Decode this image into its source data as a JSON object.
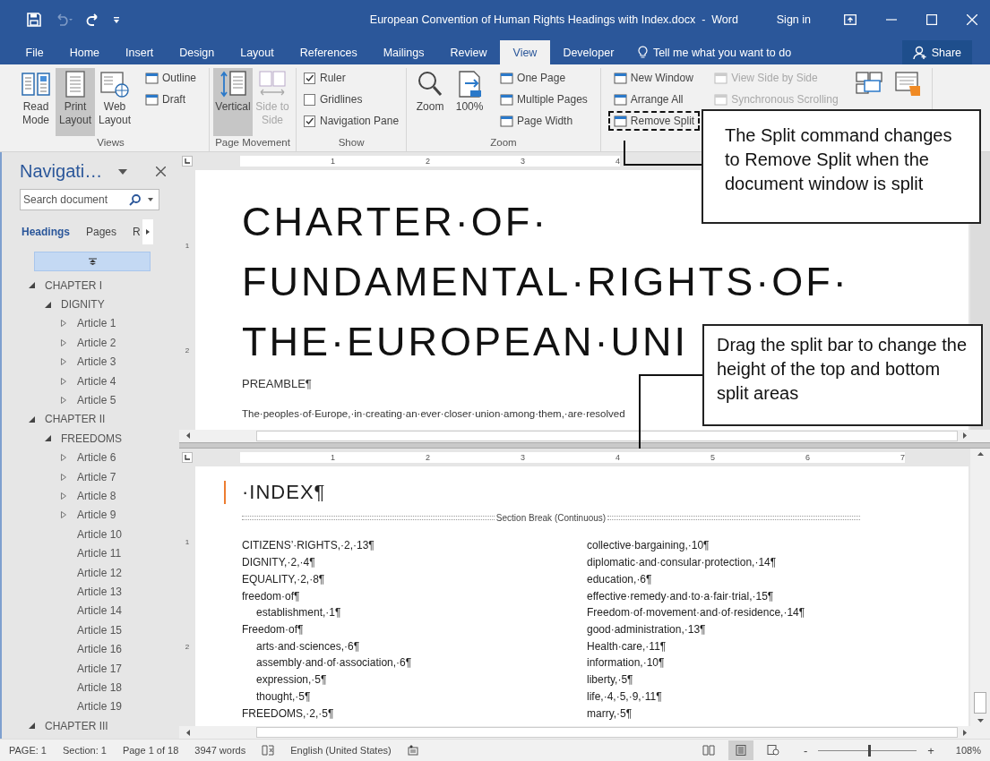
{
  "window": {
    "title": "European Convention of Human Rights Headings with Index.docx  -  Word",
    "sign_in": "Sign in"
  },
  "ribbon_tabs": [
    {
      "label": "File",
      "selected": false
    },
    {
      "label": "Home",
      "selected": false
    },
    {
      "label": "Insert",
      "selected": false
    },
    {
      "label": "Design",
      "selected": false
    },
    {
      "label": "Layout",
      "selected": false
    },
    {
      "label": "References",
      "selected": false
    },
    {
      "label": "Mailings",
      "selected": false
    },
    {
      "label": "Review",
      "selected": false
    },
    {
      "label": "View",
      "selected": true
    },
    {
      "label": "Developer",
      "selected": false
    }
  ],
  "tell_me": "Tell me what you want to do",
  "share": "Share",
  "ribbon": {
    "groups": [
      {
        "label": "Views",
        "columns": [
          {
            "kind": "large",
            "items": [
              {
                "label": "Read Mode",
                "selected": false,
                "disabled": false
              },
              {
                "label": "Print Layout",
                "selected": true,
                "disabled": false
              },
              {
                "label": "Web Layout",
                "selected": false,
                "disabled": false
              }
            ]
          },
          {
            "kind": "stack",
            "items": [
              {
                "label": "Outline",
                "disabled": false,
                "annotated": false
              },
              {
                "label": "Draft",
                "disabled": false,
                "annotated": false
              }
            ]
          }
        ]
      },
      {
        "label": "Page Movement",
        "columns": [
          {
            "kind": "large",
            "items": [
              {
                "label": "Vertical",
                "selected": true,
                "disabled": false
              },
              {
                "label": "Side to Side",
                "selected": false,
                "disabled": true
              }
            ]
          }
        ]
      },
      {
        "label": "Show",
        "columns": [
          {
            "kind": "checks",
            "items": [
              {
                "label": "Ruler",
                "checked": true
              },
              {
                "label": "Gridlines",
                "checked": false
              },
              {
                "label": "Navigation Pane",
                "checked": true
              }
            ]
          }
        ]
      },
      {
        "label": "Zoom",
        "columns": [
          {
            "kind": "large",
            "items": [
              {
                "label": "Zoom",
                "selected": false,
                "disabled": false
              },
              {
                "label": "100%",
                "selected": false,
                "disabled": false
              }
            ]
          },
          {
            "kind": "stack",
            "items": [
              {
                "label": "One Page",
                "disabled": false,
                "annotated": false
              },
              {
                "label": "Multiple Pages",
                "disabled": false,
                "annotated": false
              },
              {
                "label": "Page Width",
                "disabled": false,
                "annotated": false
              }
            ]
          }
        ]
      },
      {
        "columns": [
          {
            "kind": "stack",
            "items": [
              {
                "label": "New Window",
                "disabled": false,
                "annotated": false
              },
              {
                "label": "Arrange All",
                "disabled": false,
                "annotated": false
              },
              {
                "label": "Remove Split",
                "disabled": false,
                "annotated": true
              }
            ]
          },
          {
            "kind": "stack",
            "items": [
              {
                "label": "View Side by Side",
                "disabled": true,
                "annotated": false
              },
              {
                "label": "Synchronous Scrolling",
                "disabled": true,
                "annotated": false
              }
            ]
          },
          {
            "kind": "large",
            "items": [
              {
                "selected": false
              },
              {
                "selected": false
              }
            ]
          }
        ]
      }
    ]
  },
  "navigation": {
    "title": "Navigati…",
    "search": {
      "placeholder": "Search document"
    },
    "tabs": [
      {
        "label": "Headings",
        "selected": true
      },
      {
        "label": "Pages",
        "selected": false
      },
      {
        "label": "R",
        "selected": false
      }
    ],
    "tree": [
      {
        "text": "CHAPTER I",
        "expanded": true,
        "children": [
          {
            "text": "DIGNITY",
            "expanded": true,
            "children": [
              {
                "text": "Article 1",
                "expanded": false
              },
              {
                "text": "Article 2",
                "expanded": false
              },
              {
                "text": "Article 3",
                "expanded": false
              },
              {
                "text": "Article 4",
                "expanded": false
              },
              {
                "text": "Article 5",
                "expanded": false
              }
            ]
          }
        ]
      },
      {
        "text": "CHAPTER II",
        "expanded": true,
        "children": [
          {
            "text": "FREEDOMS",
            "expanded": true,
            "children": [
              {
                "text": "Article 6",
                "expanded": false
              },
              {
                "text": "Article 7",
                "expanded": false
              },
              {
                "text": "Article 8",
                "expanded": false
              },
              {
                "text": "Article 9",
                "expanded": false
              },
              {
                "text": "Article 10"
              },
              {
                "text": "Article 11"
              },
              {
                "text": "Article 12"
              },
              {
                "text": "Article 13"
              },
              {
                "text": "Article 14"
              },
              {
                "text": "Article 15"
              },
              {
                "text": "Article 16"
              },
              {
                "text": "Article 17"
              },
              {
                "text": "Article 18"
              },
              {
                "text": "Article 19"
              }
            ]
          }
        ]
      },
      {
        "text": "CHAPTER III",
        "expanded": true
      }
    ]
  },
  "top_pane": {
    "ruler": [
      "1",
      "2",
      "3",
      "4"
    ],
    "vruler": [
      "1",
      "2"
    ],
    "title_lines": [
      "CHARTER·OF·",
      "FUNDAMENTAL·RIGHTS·OF·",
      "THE·EUROPEAN·UNI"
    ],
    "preamble": "PREAMBLE¶",
    "body": "The·peoples·of·Europe,·in·creating·an·ever·closer·union·among·them,·are·resolved"
  },
  "bottom_pane": {
    "ruler": [
      "1",
      "2",
      "3",
      "4",
      "5",
      "6",
      "7"
    ],
    "vruler": [
      "1",
      "2"
    ],
    "heading": "·INDEX¶",
    "section_break": "Section Break (Continuous)",
    "index_left": [
      {
        "text": "CITIZENS’·RIGHTS,·2,·13¶"
      },
      {
        "text": "DIGNITY,·2,·4¶"
      },
      {
        "text": "EQUALITY,·2,·8¶"
      },
      {
        "text": "freedom·of¶",
        "children": [
          {
            "text": "establishment,·1¶"
          }
        ]
      },
      {
        "text": "Freedom·of¶",
        "children": [
          {
            "text": "arts·and·sciences,·6¶"
          },
          {
            "text": "assembly·and·of·association,·6¶"
          },
          {
            "text": "expression,·5¶"
          },
          {
            "text": "thought,·5¶"
          }
        ]
      },
      {
        "text": "FREEDOMS,·2,·5¶"
      }
    ],
    "index_right": [
      {
        "text": "collective·bargaining,·10¶"
      },
      {
        "text": "diplomatic·and·consular·protection,·14¶"
      },
      {
        "text": "education,·6¶"
      },
      {
        "text": "effective·remedy·and·to·a·fair·trial,·15¶"
      },
      {
        "text": "Freedom·of·movement·and·of·residence,·14¶"
      },
      {
        "text": "good·administration,·13¶"
      },
      {
        "text": "Health·care,·11¶"
      },
      {
        "text": "information,·10¶"
      },
      {
        "text": "liberty,·5¶"
      },
      {
        "text": "life,·4,·5,·9,·11¶"
      },
      {
        "text": "marry,·5¶"
      }
    ]
  },
  "status_bar": {
    "page": "PAGE: 1",
    "section": "Section: 1",
    "pages": "Page 1 of 18",
    "words": "3947 words",
    "language": "English (United States)",
    "views": [
      {
        "selected": false
      },
      {
        "selected": true
      },
      {
        "selected": false
      }
    ],
    "zoom_out": "-",
    "zoom_in": "+",
    "zoom": {
      "level": 0.52
    },
    "zoom_reading": "108%"
  },
  "callouts": [
    {
      "text": "The Split command changes to Remove Split when the document window is split"
    },
    {
      "text": "Drag the split bar to change the height of the top and bottom split areas"
    }
  ]
}
